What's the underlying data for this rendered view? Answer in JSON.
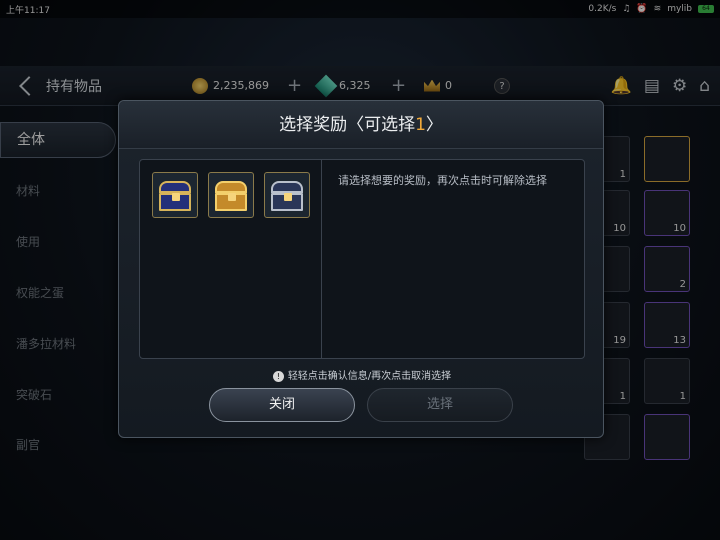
{
  "statusbar": {
    "time": "上午11:17",
    "speed": "0.2K/s",
    "carrier": "mylib",
    "battery": "64"
  },
  "hud": {
    "title": "持有物品",
    "gold": "2,235,869",
    "gems": "6,325",
    "crowns": "0",
    "help_label": "?"
  },
  "sidebar": {
    "items": [
      {
        "label": "全体"
      },
      {
        "label": "材料"
      },
      {
        "label": "使用"
      },
      {
        "label": "权能之蛋"
      },
      {
        "label": "潘多拉材料"
      },
      {
        "label": "突破石"
      },
      {
        "label": "副官"
      }
    ]
  },
  "grid_counts": [
    "1",
    "10",
    "10",
    "2",
    "19",
    "13",
    "1",
    "1"
  ],
  "modal": {
    "title_prefix": "选择奖励〈可选择",
    "title_count": "1",
    "title_suffix": "〉",
    "description": "请选择想要的奖励，再次点击时可解除选择",
    "hint": "轻轻点击确认信息/再次点击取消选择",
    "close_label": "关闭",
    "select_label": "选择"
  },
  "colors": {
    "accent": "#f0a93a",
    "panel": "#141a21",
    "border": "#4b5560"
  }
}
